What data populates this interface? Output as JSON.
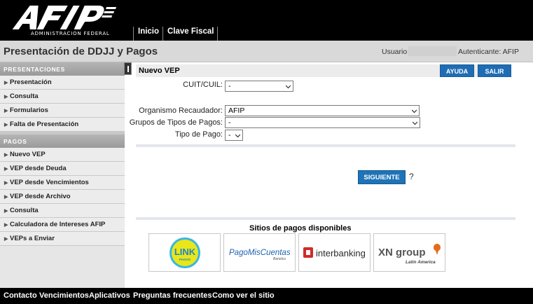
{
  "header": {
    "logo_text": "AFIP",
    "logo_subtitle": "ADMINISTRACION FEDERAL",
    "nav": [
      {
        "label": "Inicio"
      },
      {
        "label": "Clave Fiscal"
      }
    ]
  },
  "titlebar": {
    "title": "Presentación de DDJJ y Pagos",
    "user_label": "Usuario:",
    "auth_label": "Autenticante: AFIP"
  },
  "sidebar": {
    "sections": [
      {
        "heading": "Presentaciones",
        "items": [
          {
            "label": "Presentación"
          },
          {
            "label": "Consulta"
          },
          {
            "label": "Formularios"
          },
          {
            "label": "Falta de Presentación"
          }
        ]
      },
      {
        "heading": "Pagos",
        "items": [
          {
            "label": "Nuevo VEP"
          },
          {
            "label": "VEP desde Deuda"
          },
          {
            "label": "VEP desde Vencimientos"
          },
          {
            "label": "VEP desde Archivo"
          },
          {
            "label": "Consulta"
          },
          {
            "label": "Calculadora de Intereses AFIP"
          },
          {
            "label": "VEPs a Enviar"
          }
        ]
      }
    ]
  },
  "main": {
    "title": "Nuevo VEP",
    "ayuda_label": "AYUDA",
    "salir_label": "SALIR",
    "form": {
      "cuit_label": "CUIT/CUIL:",
      "cuit_value": "-",
      "organismo_label": "Organismo Recaudador:",
      "organismo_value": "AFIP",
      "grupos_label": "Grupos de Tipos de Pagos:",
      "grupos_value": "-",
      "tipo_label": "Tipo de Pago:",
      "tipo_value": "-"
    },
    "siguiente_label": "SIGUIENTE",
    "help_mark": "?",
    "sites_title": "Sitios de pagos disponibles",
    "sites": [
      {
        "logo_name": "link-pagos-logo",
        "text": "LINK",
        "subtext": "PAGOS"
      },
      {
        "logo_name": "pagomiscuentas-logo",
        "text": "PagoMisCuentas",
        "subtext": "Banelco"
      },
      {
        "logo_name": "interbanking-logo",
        "text": "interbanking"
      },
      {
        "logo_name": "xn-group-logo",
        "text": "XN group",
        "subtext": "Latin America"
      }
    ]
  },
  "footer": {
    "links": [
      {
        "label": "Contacto"
      },
      {
        "label": "Vencimientos"
      },
      {
        "label": "Aplicativos"
      },
      {
        "label": "Preguntas frecuentes"
      },
      {
        "label": "Como ver el sitio"
      }
    ]
  },
  "colors": {
    "brand_black": "#000000",
    "button_blue": "#1e6db4",
    "sidebar_bg": "#e6e6e6",
    "sidebar_heading": "#a8a8a8"
  }
}
